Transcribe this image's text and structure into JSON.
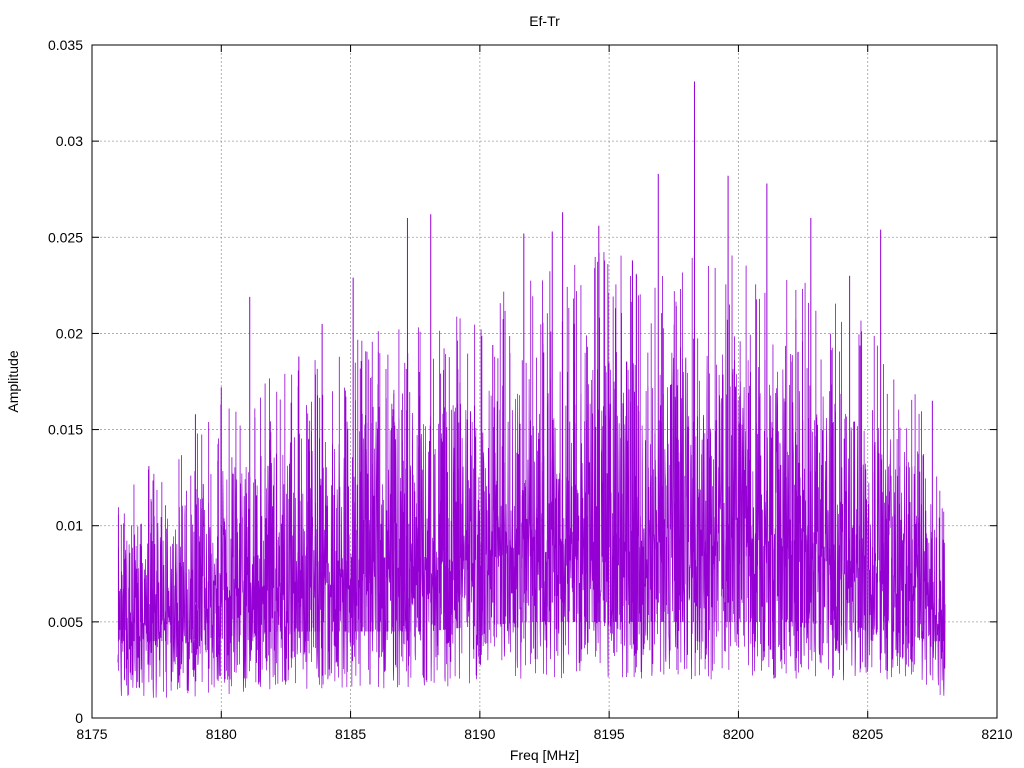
{
  "chart_data": {
    "type": "line",
    "title": "Ef-Tr",
    "xlabel": "Freq [MHz]",
    "ylabel": "Amplitude",
    "xlim": [
      8175,
      8210
    ],
    "ylim": [
      0,
      0.035
    ],
    "x_ticks": [
      "8175",
      "8180",
      "8185",
      "8190",
      "8195",
      "8200",
      "8205",
      "8210"
    ],
    "y_ticks": [
      "0",
      "0.005",
      "0.01",
      "0.015",
      "0.02",
      "0.025",
      "0.03",
      "0.035"
    ],
    "grid": true,
    "legend": "none",
    "color": "#9400d3",
    "series": [
      {
        "x_start": 8176,
        "x_end": 8208,
        "envelope_x": [
          8176,
          8178,
          8180,
          8182,
          8184,
          8186,
          8188,
          8190,
          8192,
          8194,
          8196,
          8198,
          8200,
          8202,
          8204,
          8206,
          8207.5,
          8208
        ],
        "envelope_low": [
          0.001,
          0.001,
          0.0012,
          0.0015,
          0.0015,
          0.0015,
          0.0015,
          0.0018,
          0.002,
          0.002,
          0.002,
          0.002,
          0.002,
          0.002,
          0.0018,
          0.0015,
          0.001,
          0.001
        ],
        "envelope_high": [
          0.009,
          0.011,
          0.013,
          0.014,
          0.015,
          0.016,
          0.016,
          0.017,
          0.018,
          0.019,
          0.019,
          0.019,
          0.019,
          0.018,
          0.017,
          0.015,
          0.012,
          0.009
        ],
        "peaks": [
          {
            "x": 8177.2,
            "y": 0.0131
          },
          {
            "x": 8179.0,
            "y": 0.0158
          },
          {
            "x": 8180.0,
            "y": 0.0172
          },
          {
            "x": 8181.1,
            "y": 0.0219
          },
          {
            "x": 8183.0,
            "y": 0.0188
          },
          {
            "x": 8183.9,
            "y": 0.0205
          },
          {
            "x": 8185.1,
            "y": 0.0229
          },
          {
            "x": 8187.2,
            "y": 0.026
          },
          {
            "x": 8188.1,
            "y": 0.0262
          },
          {
            "x": 8190.5,
            "y": 0.0194
          },
          {
            "x": 8191.7,
            "y": 0.0252
          },
          {
            "x": 8192.8,
            "y": 0.0253
          },
          {
            "x": 8193.2,
            "y": 0.0263
          },
          {
            "x": 8194.6,
            "y": 0.0256
          },
          {
            "x": 8195.9,
            "y": 0.0238
          },
          {
            "x": 8196.9,
            "y": 0.0283
          },
          {
            "x": 8198.3,
            "y": 0.0331
          },
          {
            "x": 8199.6,
            "y": 0.0282
          },
          {
            "x": 8201.1,
            "y": 0.0278
          },
          {
            "x": 8202.8,
            "y": 0.026
          },
          {
            "x": 8204.3,
            "y": 0.023
          },
          {
            "x": 8205.5,
            "y": 0.0254
          },
          {
            "x": 8207.5,
            "y": 0.0165
          }
        ]
      }
    ]
  }
}
